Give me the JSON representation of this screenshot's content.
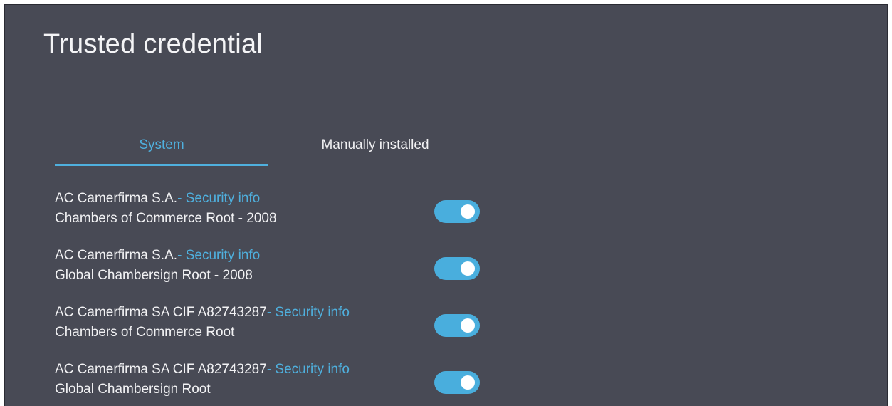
{
  "header": {
    "title": "Trusted credential"
  },
  "tabs": [
    {
      "label": "System",
      "selected": true
    },
    {
      "label": "Manually installed",
      "selected": false
    }
  ],
  "colors": {
    "background": "#484a55",
    "accent": "#4fb0de",
    "text": "#f2f2f4"
  },
  "certificates": [
    {
      "issuer": "AC Camerfirma S.A.",
      "link": "- Security info",
      "name": "Chambers of Commerce Root - 2008",
      "enabled": true
    },
    {
      "issuer": "AC Camerfirma S.A.",
      "link": "- Security info",
      "name": "Global Chambersign Root - 2008",
      "enabled": true
    },
    {
      "issuer": "AC Camerfirma SA CIF A82743287",
      "link": "- Security info",
      "name": "Chambers of Commerce Root",
      "enabled": true
    },
    {
      "issuer": "AC Camerfirma SA CIF A82743287",
      "link": "- Security info",
      "name": "Global Chambersign Root",
      "enabled": true
    }
  ]
}
